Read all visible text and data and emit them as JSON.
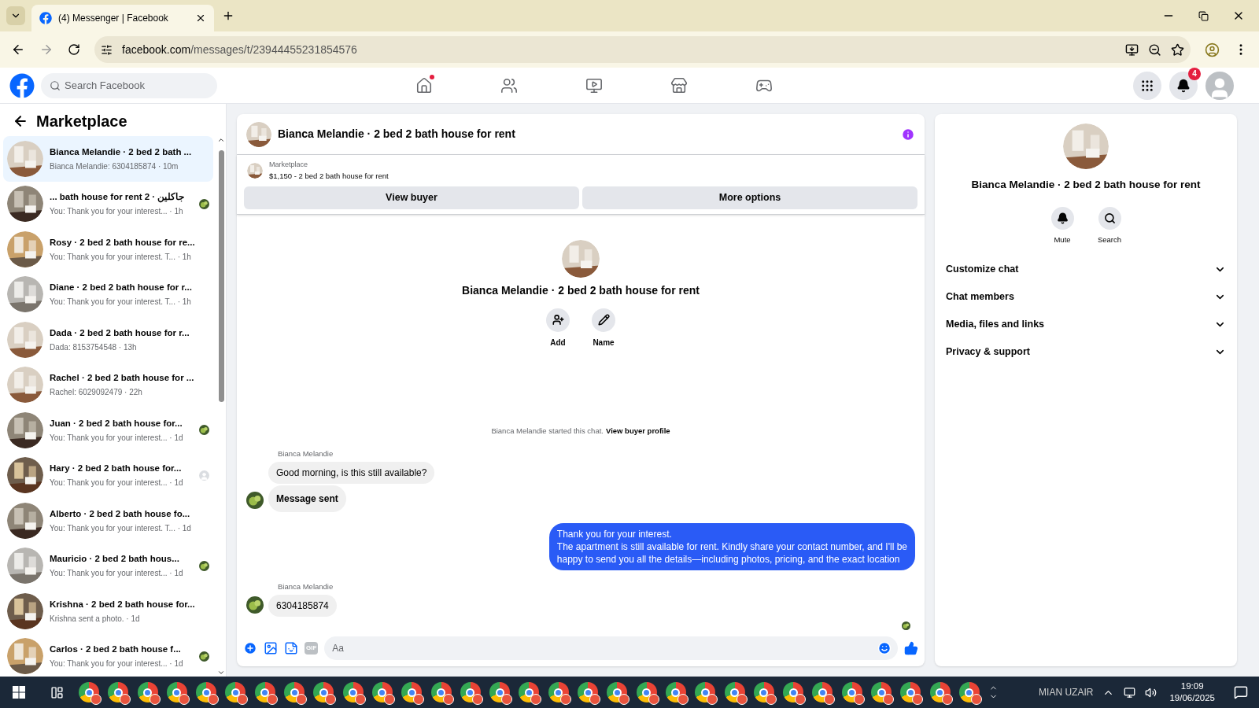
{
  "browser": {
    "tab_title": "(4) Messenger | Facebook",
    "url_host": "facebook.com",
    "url_path": "/messages/t/23944455231854576"
  },
  "header": {
    "search_placeholder": "Search Facebook",
    "notification_count": "4",
    "nav": [
      {
        "kind": "home",
        "unread": true
      },
      {
        "kind": "friends",
        "unread": false
      },
      {
        "kind": "video",
        "unread": false
      },
      {
        "kind": "marketplace",
        "unread": false
      },
      {
        "kind": "gaming",
        "unread": false
      }
    ]
  },
  "sidebar": {
    "title": "Marketplace",
    "conversations": [
      {
        "kind": "plain",
        "title": "Bianca Melandie · 2 bed 2 bath ...",
        "preview": "Bianca Melandie: 6304185874 · 10m",
        "selected": true
      },
      {
        "kind": "seen_photo",
        "title": "... bath house for rent 2 · جاكلين",
        "preview": "You: Thank you for your interest... · 1h",
        "selected": false
      },
      {
        "kind": "plain",
        "title": "Rosy · 2 bed 2 bath house for re...",
        "preview": "You: Thank you for your interest. T...  · 1h",
        "selected": false
      },
      {
        "kind": "plain",
        "title": "Diane · 2 bed 2 bath house for r...",
        "preview": "You: Thank you for your interest. T...  · 1h",
        "selected": false
      },
      {
        "kind": "plain",
        "title": "Dada · 2 bed 2 bath house for r...",
        "preview": "Dada: 8153754548 · 13h",
        "selected": false
      },
      {
        "kind": "plain",
        "title": "Rachel · 2 bed 2 bath house for ...",
        "preview": "Rachel: 6029092479 · 22h",
        "selected": false
      },
      {
        "kind": "seen_photo",
        "title": "Juan · 2 bed 2 bath house for...",
        "preview": "You: Thank you for your interest... · 1d",
        "selected": false
      },
      {
        "kind": "seen_silhouette",
        "title": "Hary · 2 bed 2 bath house for...",
        "preview": "You: Thank you for your interest... · 1d",
        "selected": false
      },
      {
        "kind": "plain",
        "title": "Alberto · 2 bed 2 bath house fo...",
        "preview": "You: Thank you for your interest. T...  · 1d",
        "selected": false
      },
      {
        "kind": "seen_photo",
        "title": "Mauricio · 2 bed 2 bath hous...",
        "preview": "You: Thank you for your interest... · 1d",
        "selected": false
      },
      {
        "kind": "plain",
        "title": "Krishna · 2 bed 2 bath house for...",
        "preview": "Krishna sent a photo. · 1d",
        "selected": false
      },
      {
        "kind": "seen_photo",
        "title": "Carlos · 2 bed 2 bath house f...",
        "preview": "You: Thank you for your interest... · 1d",
        "selected": false
      }
    ]
  },
  "chat": {
    "title": "Bianca Melandie · 2 bed 2 bath house for rent",
    "listing_source": "Marketplace",
    "listing": "$1,150 - 2 bed 2 bath house for rent",
    "buttons": [
      "View buyer",
      "More options"
    ],
    "intro_title": "Bianca Melandie · 2 bed 2 bath house for rent",
    "intro_actions": [
      {
        "kind": "add",
        "label": "Add"
      },
      {
        "kind": "name",
        "label": "Name"
      }
    ],
    "system_note": "Bianca Melandie started this chat.",
    "system_link": "View buyer profile",
    "groups": [
      {
        "kind": "incoming",
        "sender": "Bianca Melandie",
        "messages": [
          {
            "lines": [
              "Good morning, is this still available?"
            ],
            "bold": false
          },
          {
            "lines": [
              "Message sent"
            ],
            "bold": true
          }
        ]
      },
      {
        "kind": "outgoing",
        "messages": [
          {
            "lines": [
              "Thank you for your interest.",
              "The apartment is still available for rent. Kindly share your contact number, and I'll be",
              "happy to send you all the details—including photos, pricing, and the exact location"
            ],
            "bold": false
          }
        ]
      },
      {
        "kind": "incoming",
        "sender": "Bianca Melandie",
        "messages": [
          {
            "lines": [
              "6304185874"
            ],
            "bold": false
          }
        ]
      }
    ],
    "composer_placeholder": "Aa",
    "gif_label": "GIF"
  },
  "details": {
    "title": "Bianca Melandie · 2 bed 2 bath house for rent",
    "actions": [
      {
        "kind": "mute",
        "label": "Mute"
      },
      {
        "kind": "search",
        "label": "Search"
      }
    ],
    "sections": [
      {
        "label": "Customize chat",
        "expanded": false
      },
      {
        "label": "Chat members",
        "expanded": false
      },
      {
        "label": "Media, files and links",
        "expanded": false
      },
      {
        "label": "Privacy & support",
        "expanded": false
      }
    ]
  },
  "taskbar": {
    "user": "MIAN UZAIR",
    "time": "19:09",
    "date": "19/06/2025"
  }
}
